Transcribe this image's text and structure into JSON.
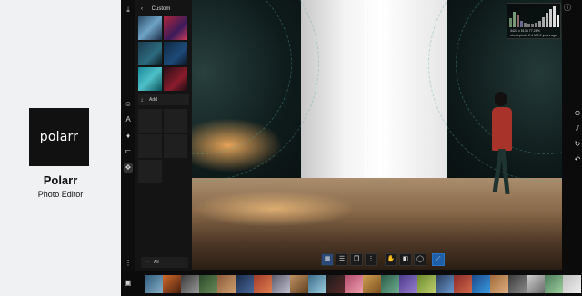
{
  "promo": {
    "logo_text": "polarr",
    "app_name": "Polarr",
    "app_subtitle": "Photo Editor"
  },
  "panel": {
    "title": "Custom",
    "add_label": "Add",
    "filter_label": "All"
  },
  "histogram": {
    "line1": "3422 x 5134   77.28%",
    "line2": "street-photo  2.4 MB   2 years ago"
  },
  "colors": {
    "accent": "#1e5fa8",
    "panel_bg": "#141414",
    "app_bg": "#0b0b0b",
    "promo_bg": "#f0f1f3",
    "coat": "#a8332a"
  },
  "icons": {
    "rail": [
      "download-icon",
      "face-icon",
      "text-icon",
      "brush-icon",
      "crop-icon",
      "filter-icon",
      "more-icon"
    ],
    "right_tools": [
      "crop-icon",
      "magic-icon",
      "refresh-icon",
      "undo-icon"
    ],
    "toolbar": [
      "filter-icon",
      "adjust-icon",
      "copy-icon",
      "more-icon",
      "hand-icon",
      "compare-icon",
      "mask-icon",
      "pin-icon"
    ]
  }
}
